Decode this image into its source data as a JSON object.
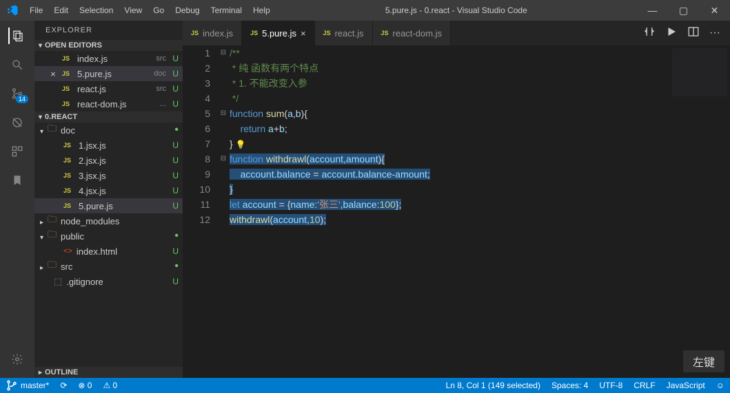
{
  "titlebar": {
    "menu": [
      "File",
      "Edit",
      "Selection",
      "View",
      "Go",
      "Debug",
      "Terminal",
      "Help"
    ],
    "title": "5.pure.js - 0.react - Visual Studio Code",
    "min": "—",
    "max": "▢",
    "close": "✕"
  },
  "activity": {
    "scm_badge": "14"
  },
  "sidebar": {
    "header": "EXPLORER",
    "open_editors_label": "OPEN EDITORS",
    "open_editors": [
      {
        "name": "index.js",
        "hint": "src",
        "status": "U",
        "active": false,
        "close": false
      },
      {
        "name": "5.pure.js",
        "hint": "doc",
        "status": "U",
        "active": true,
        "close": true
      },
      {
        "name": "react.js",
        "hint": "src",
        "status": "U",
        "active": false,
        "close": false
      },
      {
        "name": "react-dom.js",
        "hint": "...",
        "status": "U",
        "active": false,
        "close": false
      }
    ],
    "project_label": "0.REACT",
    "tree": [
      {
        "type": "folder",
        "name": "doc",
        "open": true,
        "dot": true,
        "indent": 0
      },
      {
        "type": "js",
        "name": "1.jsx.js",
        "status": "U",
        "indent": 1
      },
      {
        "type": "js",
        "name": "2.jsx.js",
        "status": "U",
        "indent": 1
      },
      {
        "type": "js",
        "name": "3.jsx.js",
        "status": "U",
        "indent": 1
      },
      {
        "type": "js",
        "name": "4.jsx.js",
        "status": "U",
        "indent": 1
      },
      {
        "type": "js",
        "name": "5.pure.js",
        "status": "U",
        "indent": 1,
        "active": true
      },
      {
        "type": "folder",
        "name": "node_modules",
        "open": false,
        "indent": 0
      },
      {
        "type": "folder",
        "name": "public",
        "open": true,
        "dot": true,
        "indent": 0
      },
      {
        "type": "html",
        "name": "index.html",
        "status": "U",
        "indent": 1
      },
      {
        "type": "folder",
        "name": "src",
        "open": false,
        "dot": true,
        "indent": 0
      },
      {
        "type": "file",
        "name": ".gitignore",
        "status": "U",
        "indent": 0
      }
    ],
    "outline_label": "OUTLINE"
  },
  "tabs": [
    {
      "name": "index.js",
      "active": false
    },
    {
      "name": "5.pure.js",
      "active": true
    },
    {
      "name": "react.js",
      "active": false
    },
    {
      "name": "react-dom.js",
      "active": false
    }
  ],
  "code": {
    "lines": [
      {
        "n": 1,
        "fold": "⊟",
        "seg": [
          {
            "c": "c-comment",
            "t": "/**"
          }
        ]
      },
      {
        "n": 2,
        "seg": [
          {
            "c": "c-comment",
            "t": " * 纯 函数有两个特点"
          }
        ]
      },
      {
        "n": 3,
        "seg": [
          {
            "c": "c-comment",
            "t": " * 1. 不能改变入参"
          }
        ]
      },
      {
        "n": 4,
        "seg": [
          {
            "c": "c-comment",
            "t": " */"
          }
        ]
      },
      {
        "n": 5,
        "fold": "⊟",
        "seg": [
          {
            "c": "c-key",
            "t": "function "
          },
          {
            "c": "c-fn",
            "t": "sum"
          },
          {
            "c": "c-plain",
            "t": "("
          },
          {
            "c": "c-var",
            "t": "a"
          },
          {
            "c": "c-plain",
            "t": ","
          },
          {
            "c": "c-var",
            "t": "b"
          },
          {
            "c": "c-plain",
            "t": "){"
          }
        ]
      },
      {
        "n": 6,
        "seg": [
          {
            "c": "c-plain",
            "t": "    "
          },
          {
            "c": "c-key",
            "t": "return "
          },
          {
            "c": "c-var",
            "t": "a"
          },
          {
            "c": "c-plain",
            "t": "+"
          },
          {
            "c": "c-var",
            "t": "b"
          },
          {
            "c": "c-plain",
            "t": ";"
          }
        ]
      },
      {
        "n": 7,
        "bulb": true,
        "seg": [
          {
            "c": "c-plain",
            "t": "}"
          }
        ]
      },
      {
        "n": 8,
        "fold": "⊟",
        "sel": true,
        "seg": [
          {
            "c": "c-key",
            "t": "function "
          },
          {
            "c": "c-fn",
            "t": "withdrawl"
          },
          {
            "c": "c-plain",
            "t": "("
          },
          {
            "c": "c-var",
            "t": "account"
          },
          {
            "c": "c-plain",
            "t": ","
          },
          {
            "c": "c-var",
            "t": "amount"
          },
          {
            "c": "c-plain",
            "t": "){"
          }
        ]
      },
      {
        "n": 9,
        "sel": true,
        "seg": [
          {
            "c": "c-plain",
            "t": "    "
          },
          {
            "c": "c-var",
            "t": "account"
          },
          {
            "c": "c-plain",
            "t": "."
          },
          {
            "c": "c-var",
            "t": "balance"
          },
          {
            "c": "c-plain",
            "t": " = "
          },
          {
            "c": "c-var",
            "t": "account"
          },
          {
            "c": "c-plain",
            "t": "."
          },
          {
            "c": "c-var",
            "t": "balance"
          },
          {
            "c": "c-plain",
            "t": "-"
          },
          {
            "c": "c-var",
            "t": "amount"
          },
          {
            "c": "c-plain",
            "t": ";"
          }
        ]
      },
      {
        "n": 10,
        "sel": true,
        "seg": [
          {
            "c": "c-plain",
            "t": "}"
          }
        ]
      },
      {
        "n": 11,
        "sel": true,
        "seg": [
          {
            "c": "c-key",
            "t": "let "
          },
          {
            "c": "c-var",
            "t": "account"
          },
          {
            "c": "c-plain",
            "t": " = {"
          },
          {
            "c": "c-var",
            "t": "name"
          },
          {
            "c": "c-plain",
            "t": ":"
          },
          {
            "c": "c-str",
            "t": "'张三'"
          },
          {
            "c": "c-plain",
            "t": ","
          },
          {
            "c": "c-var",
            "t": "balance"
          },
          {
            "c": "c-plain",
            "t": ":"
          },
          {
            "c": "c-num",
            "t": "100"
          },
          {
            "c": "c-plain",
            "t": "};"
          }
        ]
      },
      {
        "n": 12,
        "sel": true,
        "seg": [
          {
            "c": "c-fn",
            "t": "withdrawl"
          },
          {
            "c": "c-plain",
            "t": "("
          },
          {
            "c": "c-var",
            "t": "account"
          },
          {
            "c": "c-plain",
            "t": ","
          },
          {
            "c": "c-num",
            "t": "10"
          },
          {
            "c": "c-plain",
            "t": ");"
          }
        ]
      }
    ]
  },
  "status": {
    "branch": "master*",
    "sync": "⟳",
    "errors": "⊗ 0",
    "warnings": "⚠ 0",
    "cursor": "Ln 8, Col 1 (149 selected)",
    "spaces": "Spaces: 4",
    "encoding": "UTF-8",
    "eol": "CRLF",
    "lang": "JavaScript",
    "feedback": "☺"
  },
  "overlay": "左键"
}
